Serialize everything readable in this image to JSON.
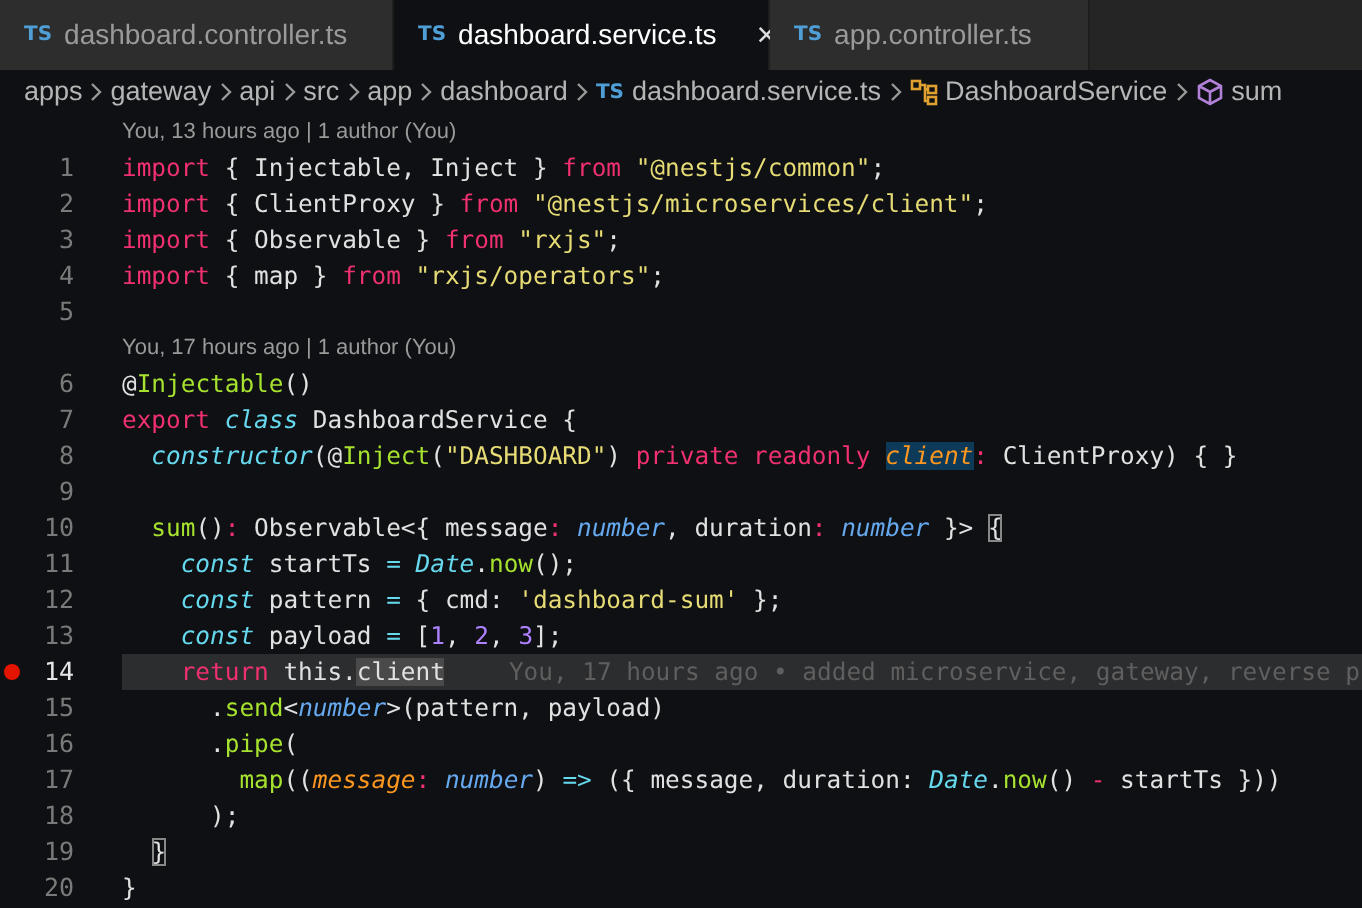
{
  "tabs": [
    {
      "icon_text": "TS",
      "label": "dashboard.controller.ts",
      "selected": false
    },
    {
      "icon_text": "TS",
      "label": "dashboard.service.ts",
      "selected": true,
      "close": "×"
    },
    {
      "icon_text": "TS",
      "label": "app.controller.ts",
      "selected": false
    }
  ],
  "breadcrumb": [
    {
      "kind": "folder",
      "label": "apps"
    },
    {
      "kind": "folder",
      "label": "gateway"
    },
    {
      "kind": "folder",
      "label": "api"
    },
    {
      "kind": "folder",
      "label": "src"
    },
    {
      "kind": "folder",
      "label": "app"
    },
    {
      "kind": "folder",
      "label": "dashboard"
    },
    {
      "kind": "file",
      "icon_text": "TS",
      "label": "dashboard.service.ts"
    },
    {
      "kind": "class",
      "label": "DashboardService"
    },
    {
      "kind": "method",
      "label": "sum"
    }
  ],
  "editor": {
    "rows": [
      {
        "kind": "lens",
        "text": "You, 13 hours ago | 1 author (You)"
      },
      {
        "kind": "code",
        "number": "1",
        "tokens": [
          {
            "text": "import",
            "kind": "kw"
          },
          {
            "text": " { Injectable, Inject } ",
            "kind": "plain"
          },
          {
            "text": "from ",
            "kind": "kw"
          },
          {
            "text": "\"@nestjs/common\"",
            "kind": "str"
          },
          {
            "text": ";",
            "kind": "plain"
          }
        ]
      },
      {
        "kind": "code",
        "number": "2",
        "tokens": [
          {
            "text": "import",
            "kind": "kw"
          },
          {
            "text": " { ClientProxy } ",
            "kind": "plain"
          },
          {
            "text": "from ",
            "kind": "kw"
          },
          {
            "text": "\"@nestjs/microservices/client\"",
            "kind": "str"
          },
          {
            "text": ";",
            "kind": "plain"
          }
        ]
      },
      {
        "kind": "code",
        "number": "3",
        "tokens": [
          {
            "text": "import",
            "kind": "kw"
          },
          {
            "text": " { Observable } ",
            "kind": "plain"
          },
          {
            "text": "from ",
            "kind": "kw"
          },
          {
            "text": "\"rxjs\"",
            "kind": "str"
          },
          {
            "text": ";",
            "kind": "plain"
          }
        ]
      },
      {
        "kind": "code",
        "number": "4",
        "tokens": [
          {
            "text": "import",
            "kind": "kw"
          },
          {
            "text": " { map } ",
            "kind": "plain"
          },
          {
            "text": "from ",
            "kind": "kw"
          },
          {
            "text": "\"rxjs/operators\"",
            "kind": "str"
          },
          {
            "text": ";",
            "kind": "plain"
          }
        ]
      },
      {
        "kind": "code",
        "number": "5"
      },
      {
        "kind": "lens",
        "text": "You, 17 hours ago | 1 author (You)"
      },
      {
        "kind": "code",
        "number": "6",
        "tokens": [
          {
            "text": "@",
            "kind": "plain"
          },
          {
            "text": "Injectable",
            "kind": "fn"
          },
          {
            "text": "()",
            "kind": "plain"
          }
        ]
      },
      {
        "kind": "code",
        "number": "7",
        "tokens": [
          {
            "text": "export ",
            "kind": "kw"
          },
          {
            "text": "class",
            "kind": "stor"
          },
          {
            "text": " DashboardService {",
            "kind": "plain"
          }
        ]
      },
      {
        "kind": "code",
        "number": "8",
        "tokens": [
          {
            "text": "  constructor",
            "kind": "stor"
          },
          {
            "text": "(@",
            "kind": "plain"
          },
          {
            "text": "Inject",
            "kind": "fn"
          },
          {
            "text": "(",
            "kind": "plain"
          },
          {
            "text": "\"DASHBOARD\"",
            "kind": "str"
          },
          {
            "text": ") ",
            "kind": "plain"
          },
          {
            "text": "private readonly ",
            "kind": "kw"
          },
          {
            "text": "client",
            "kind": "param",
            "highlighted": true
          },
          {
            "text": ":",
            "kind": "op"
          },
          {
            "text": " ClientProxy) { }",
            "kind": "plain"
          }
        ]
      },
      {
        "kind": "code",
        "number": "9"
      },
      {
        "kind": "code",
        "number": "10",
        "tokens": [
          {
            "text": "  sum",
            "kind": "fn"
          },
          {
            "text": "()",
            "kind": "plain"
          },
          {
            "text": ":",
            "kind": "op"
          },
          {
            "text": " Observable<{ message",
            "kind": "plain"
          },
          {
            "text": ": ",
            "kind": "op"
          },
          {
            "text": "number",
            "kind": "type"
          },
          {
            "text": ", duration",
            "kind": "plain"
          },
          {
            "text": ": ",
            "kind": "op"
          },
          {
            "text": "number",
            "kind": "type"
          },
          {
            "text": " }> ",
            "kind": "plain"
          },
          {
            "text": "{",
            "kind": "plain",
            "bracket_match": true
          }
        ]
      },
      {
        "kind": "code",
        "number": "11",
        "tokens": [
          {
            "text": "    const",
            "kind": "stor"
          },
          {
            "text": " startTs ",
            "kind": "plain"
          },
          {
            "text": "= ",
            "kind": "eq"
          },
          {
            "text": "Date",
            "kind": "cls"
          },
          {
            "text": ".",
            "kind": "plain"
          },
          {
            "text": "now",
            "kind": "fn"
          },
          {
            "text": "();",
            "kind": "plain"
          }
        ]
      },
      {
        "kind": "code",
        "number": "12",
        "tokens": [
          {
            "text": "    const",
            "kind": "stor"
          },
          {
            "text": " pattern ",
            "kind": "plain"
          },
          {
            "text": "=",
            "kind": "eq"
          },
          {
            "text": " { cmd: ",
            "kind": "plain"
          },
          {
            "text": "'dashboard-sum'",
            "kind": "str"
          },
          {
            "text": " };",
            "kind": "plain"
          }
        ]
      },
      {
        "kind": "code",
        "number": "13",
        "tokens": [
          {
            "text": "    const",
            "kind": "stor"
          },
          {
            "text": " payload ",
            "kind": "plain"
          },
          {
            "text": "=",
            "kind": "eq"
          },
          {
            "text": " [",
            "kind": "plain"
          },
          {
            "text": "1",
            "kind": "num"
          },
          {
            "text": ", ",
            "kind": "plain"
          },
          {
            "text": "2",
            "kind": "num"
          },
          {
            "text": ", ",
            "kind": "plain"
          },
          {
            "text": "3",
            "kind": "num"
          },
          {
            "text": "];",
            "kind": "plain"
          }
        ]
      },
      {
        "kind": "code",
        "number": "14",
        "breakpoint": true,
        "current": true,
        "blame": "You, 17 hours ago • added microservice, gateway, reverse p",
        "tokens": [
          {
            "text": "    return",
            "kind": "kw"
          },
          {
            "text": " this.",
            "kind": "plain"
          },
          {
            "text": "client",
            "kind": "plain",
            "selected": true
          }
        ]
      },
      {
        "kind": "code",
        "number": "15",
        "tokens": [
          {
            "text": "      .",
            "kind": "plain"
          },
          {
            "text": "send",
            "kind": "fn"
          },
          {
            "text": "<",
            "kind": "plain"
          },
          {
            "text": "number",
            "kind": "type"
          },
          {
            "text": ">(pattern, payload)",
            "kind": "plain"
          }
        ]
      },
      {
        "kind": "code",
        "number": "16",
        "tokens": [
          {
            "text": "      .",
            "kind": "plain"
          },
          {
            "text": "pipe",
            "kind": "fn"
          },
          {
            "text": "(",
            "kind": "plain"
          }
        ]
      },
      {
        "kind": "code",
        "number": "17",
        "tokens": [
          {
            "text": "        map",
            "kind": "fn"
          },
          {
            "text": "((",
            "kind": "plain"
          },
          {
            "text": "message",
            "kind": "param"
          },
          {
            "text": ": ",
            "kind": "op"
          },
          {
            "text": "number",
            "kind": "type"
          },
          {
            "text": ") ",
            "kind": "plain"
          },
          {
            "text": "=>",
            "kind": "eq"
          },
          {
            "text": " ({ message, duration: ",
            "kind": "plain"
          },
          {
            "text": "Date",
            "kind": "cls"
          },
          {
            "text": ".",
            "kind": "plain"
          },
          {
            "text": "now",
            "kind": "fn"
          },
          {
            "text": "() ",
            "kind": "plain"
          },
          {
            "text": "-",
            "kind": "op"
          },
          {
            "text": " startTs }))",
            "kind": "plain"
          }
        ]
      },
      {
        "kind": "code",
        "number": "18",
        "tokens": [
          {
            "text": "      );",
            "kind": "plain"
          }
        ]
      },
      {
        "kind": "code",
        "number": "19",
        "tokens": [
          {
            "text": "  }",
            "kind": "plain",
            "bracket_match": true
          }
        ]
      },
      {
        "kind": "code",
        "number": "20",
        "tokens": [
          {
            "text": "}",
            "kind": "plain"
          }
        ]
      }
    ]
  }
}
